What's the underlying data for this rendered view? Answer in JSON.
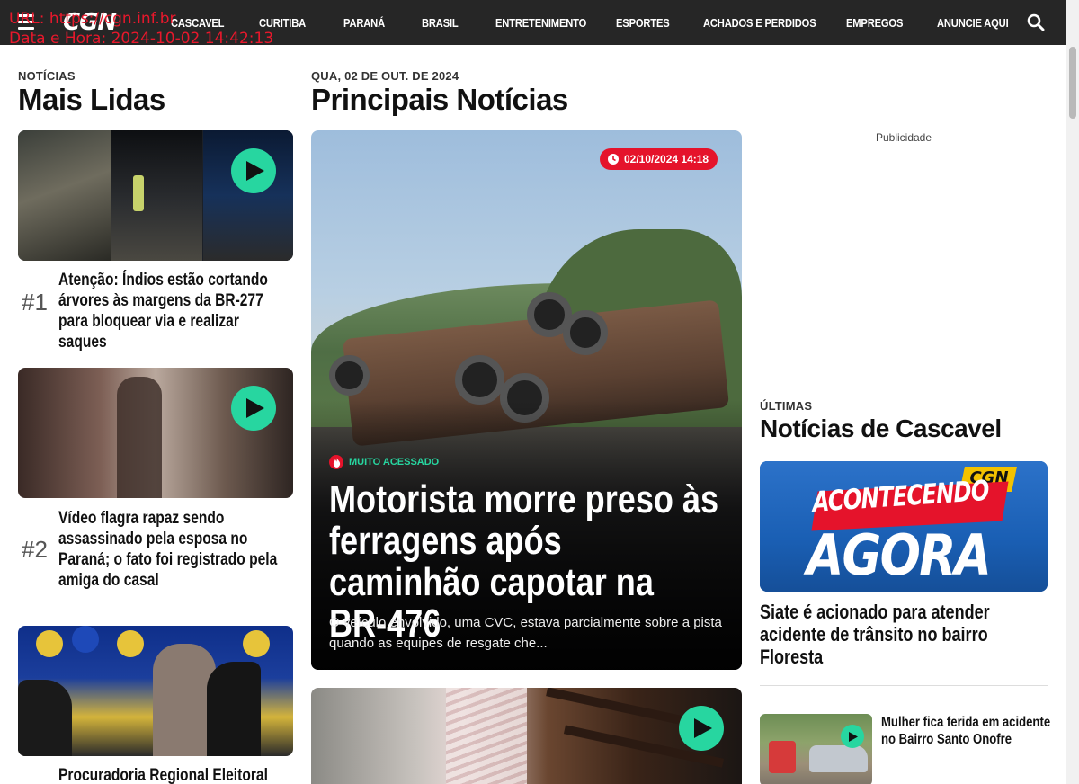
{
  "overlay": {
    "url_line": "URL: https://cgn.inf.br",
    "date_line": "Data e Hora: 2024-10-02 14:42:13"
  },
  "nav": {
    "logo": "CGN",
    "items": [
      "CASCAVEL",
      "CURITIBA",
      "PARANÁ",
      "BRASIL",
      "ENTRETENIMENTO",
      "ESPORTES",
      "ACHADOS E PERDIDOS",
      "EMPREGOS",
      "ANUNCIE AQUI"
    ],
    "icons": {
      "menu": "hamburger-icon",
      "search": "search-icon"
    }
  },
  "most_read": {
    "kicker": "NOTÍCIAS",
    "title": "Mais Lidas",
    "items": [
      {
        "rank": "#1",
        "title": "Atenção: Índios estão cortando árvores às margens da BR-277 para bloquear via e realizar saques",
        "video": true
      },
      {
        "rank": "#2",
        "title": "Vídeo flagra rapaz sendo assassinado pela esposa no Paraná; o fato foi registrado pela amiga do casal",
        "video": true
      },
      {
        "rank": "",
        "title": "Procuradoria Regional Eleitoral",
        "video": false
      }
    ]
  },
  "main": {
    "kicker": "QUA, 02 DE OUT. DE 2024",
    "title": "Principais Notícias",
    "hero": {
      "timestamp": "02/10/2024 14:18",
      "tag": "MUITO ACESSADO",
      "headline": "Motorista morre preso às ferragens após caminhão capotar na BR-476",
      "summary": "O veículo envolvido, uma CVC, estava parcialmente sobre a pista quando as equipes de resgate che..."
    }
  },
  "sidebar": {
    "ad_label": "Publicidade",
    "kicker": "ÚLTIMAS",
    "title": "Notícias de Cascavel",
    "banner": {
      "brand": "CGN",
      "line1": "ACONTECENDO",
      "line2": "AGORA"
    },
    "lead_title": "Siate é acionado para atender acidente de trânsito no bairro Floresta",
    "list": [
      {
        "title": "Mulher fica ferida em acidente no Bairro Santo Onofre"
      }
    ]
  },
  "colors": {
    "nav_bg": "#262626",
    "accent_red": "#e5132b",
    "accent_green": "#27d6a0",
    "banner_blue": "#1a5fb4"
  }
}
